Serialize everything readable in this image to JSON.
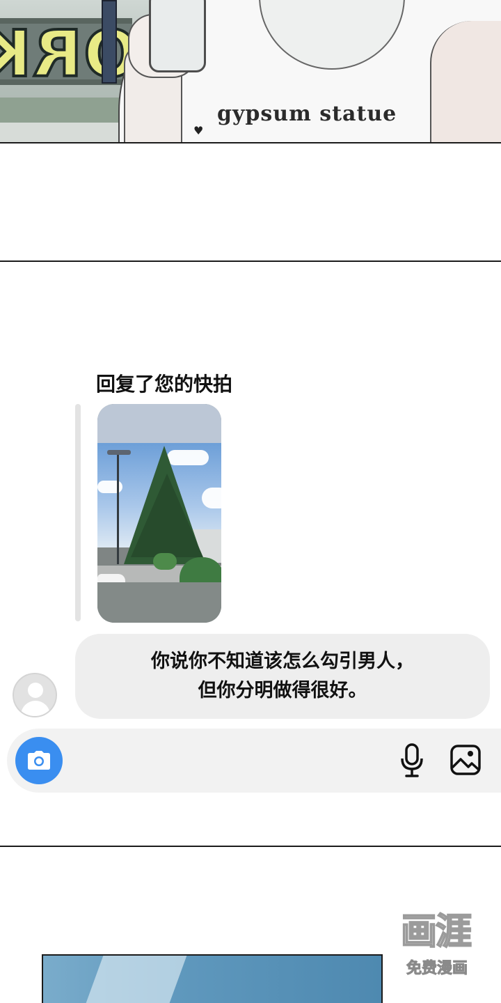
{
  "top_panel": {
    "sign_text": "ORK",
    "shirt_print": "gypsum statue"
  },
  "chat": {
    "reply_caption": "回复了您的快拍",
    "message": {
      "line1": "你说你不知道该怎么勾引男人，",
      "line2": "但你分明做得很好。"
    },
    "composer": {
      "camera_icon": "camera-icon",
      "mic_icon": "microphone-icon",
      "gallery_icon": "image-icon",
      "accent_color": "#3a8ef0",
      "bubble_color": "#eeeeee"
    }
  },
  "watermark": {
    "logo": "画涯",
    "text": "免费漫画"
  }
}
